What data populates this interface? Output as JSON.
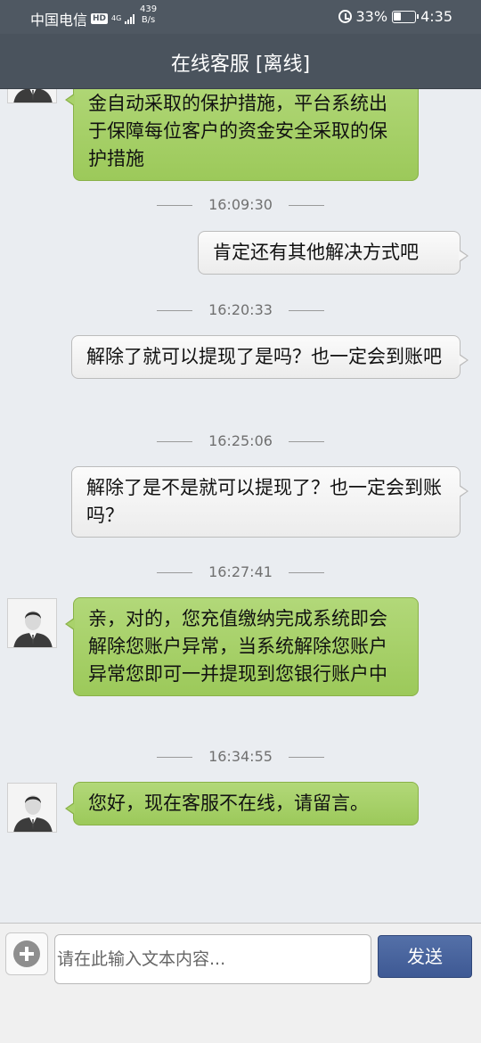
{
  "status_bar": {
    "carrier": "中国电信",
    "hd_badge": "HD",
    "net_type": "4G",
    "net_speed_value": "439",
    "net_speed_unit": "B/s",
    "battery": "33%",
    "time": "4:35"
  },
  "header": {
    "title": "在线客服 [离线]"
  },
  "messages": [
    {
      "sender": "agent",
      "text": "金自动采取的保护措施，平台系统出于保障每位客户的资金安全采取的保护措施"
    },
    {
      "timestamp": "16:09:30"
    },
    {
      "sender": "user",
      "text": "肯定还有其他解决方式吧"
    },
    {
      "timestamp": "16:20:33"
    },
    {
      "sender": "user",
      "text": "解除了就可以提现了是吗？也一定会到账吧"
    },
    {
      "timestamp": "16:25:06"
    },
    {
      "sender": "user",
      "text": "解除了是不是就可以提现了？也一定会到账吗？"
    },
    {
      "timestamp": "16:27:41"
    },
    {
      "sender": "agent",
      "text": "亲，对的，您充值缴纳完成系统即会解除您账户异常，当系统解除您账户异常您即可一并提现到您银行账户中"
    },
    {
      "timestamp": "16:34:55"
    },
    {
      "sender": "agent",
      "text": "您好，现在客服不在线，请留言。"
    }
  ],
  "input_bar": {
    "placeholder": "请在此输入文本内容...",
    "value": "",
    "send_label": "发送"
  },
  "icons": {
    "add": "plus-circle-icon",
    "avatar": "person-avatar-icon"
  },
  "colors": {
    "header_bg": "#4a535d",
    "agent_bubble": "#a9d26b",
    "user_bubble": "#f3f3f3",
    "send_button": "#4a64a0"
  }
}
